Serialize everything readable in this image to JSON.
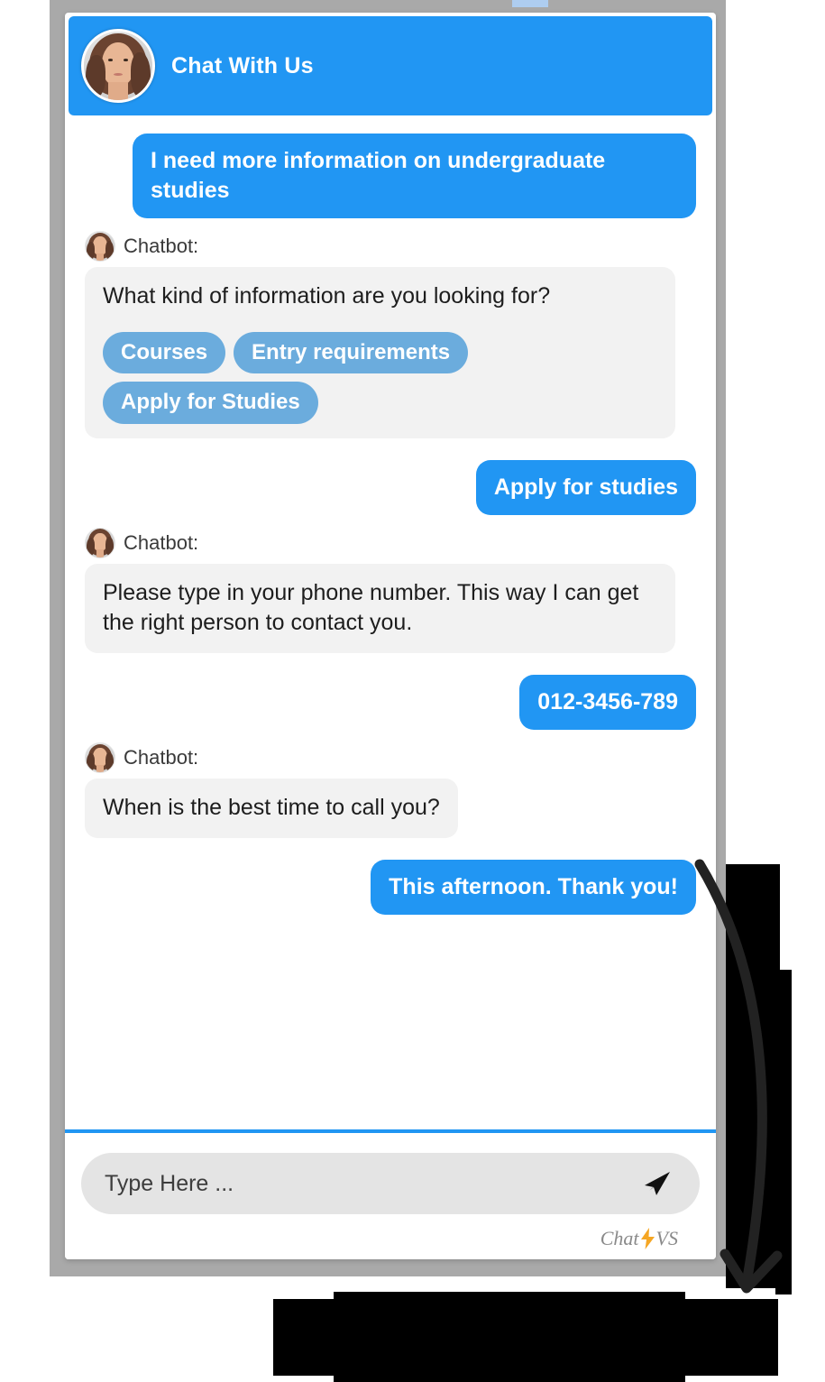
{
  "header": {
    "title": "Chat With Us",
    "avatar_icon": "woman-avatar-photo"
  },
  "conversation": [
    {
      "role": "user",
      "text": "I need more information on undergraduate studies"
    },
    {
      "role": "bot",
      "sender_label": "Chatbot:",
      "text": "What kind of information are you looking for?",
      "quick_replies": [
        "Courses",
        "Entry requirements",
        "Apply for Studies"
      ]
    },
    {
      "role": "user",
      "text": "Apply for studies"
    },
    {
      "role": "bot",
      "sender_label": "Chatbot:",
      "text": "Please type in your phone number. This way I can get the right person to contact you."
    },
    {
      "role": "user",
      "text": "012-3456-789"
    },
    {
      "role": "bot",
      "sender_label": "Chatbot:",
      "text": "When is the best time to call you?"
    },
    {
      "role": "user",
      "text": "This afternoon. Thank you!"
    }
  ],
  "composer": {
    "placeholder": "Type Here ...",
    "value": "",
    "send_icon": "paper-plane-icon"
  },
  "branding": {
    "prefix": "Chat",
    "suffix": "VS",
    "bolt_icon": "lightning-bolt-icon"
  },
  "colors": {
    "accent_blue": "#2196f3",
    "chip_blue": "#6bacdd",
    "bot_bubble": "#f2f2f2",
    "input_pill": "#e4e4e4",
    "frame_gray": "#a9a9a9",
    "bolt_orange": "#f5a623"
  }
}
